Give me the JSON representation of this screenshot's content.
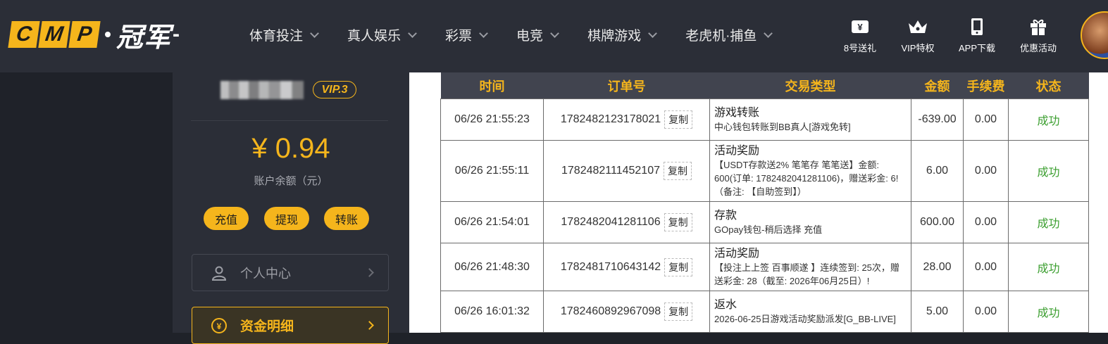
{
  "brand": {
    "logo_letters": [
      "C",
      "M",
      "P"
    ],
    "logo_cn": "冠军",
    "logo_dash": "-"
  },
  "nav": [
    {
      "label": "体育投注"
    },
    {
      "label": "真人娱乐"
    },
    {
      "label": "彩票"
    },
    {
      "label": "电竞"
    },
    {
      "label": "棋牌游戏"
    },
    {
      "label": "老虎机·捕鱼"
    }
  ],
  "quick_links": [
    {
      "label": "8号送礼",
      "icon": "gift-ticket-icon"
    },
    {
      "label": "VIP特权",
      "icon": "crown-icon"
    },
    {
      "label": "APP下载",
      "icon": "phone-icon"
    },
    {
      "label": "优惠活动",
      "icon": "gift-box-icon"
    }
  ],
  "account": {
    "vip": "VIP.3",
    "balance": "¥ 0.94",
    "balance_label": "账户余额（元）",
    "actions": [
      "充值",
      "提现",
      "转账"
    ],
    "menu_personal": "个人中心",
    "menu_funds": "资金明细"
  },
  "table": {
    "headers": [
      "时间",
      "订单号",
      "交易类型",
      "金额",
      "手续费",
      "状态"
    ],
    "copy_label": "复制",
    "rows": [
      {
        "time": "06/26 21:55:23",
        "order": "1782482123178021",
        "type": "游戏转账",
        "detail": "中心钱包转账到BB真人[游戏免转]",
        "amount": "-639.00",
        "fee": "0.00",
        "status": "成功"
      },
      {
        "time": "06/26 21:55:11",
        "order": "1782482111452107",
        "type": "活动奖励",
        "detail": "【USDT存款送2% 笔笔存 笔笔送】金额: 600(订单: 1782482041281106)，赠送彩金: 6!（备注: 【自助签到】）",
        "amount": "6.00",
        "fee": "0.00",
        "status": "成功"
      },
      {
        "time": "06/26 21:54:01",
        "order": "1782482041281106",
        "type": "存款",
        "detail": "GOpay钱包-稍后选择 充值",
        "amount": "600.00",
        "fee": "0.00",
        "status": "成功"
      },
      {
        "time": "06/26 21:48:30",
        "order": "1782481710643142",
        "type": "活动奖励",
        "detail": "【投注上上签 百事顺遂 】连续签到: 25次，赠送彩金: 28（截至: 2026年06月25日）!",
        "amount": "28.00",
        "fee": "0.00",
        "status": "成功"
      },
      {
        "time": "06/26 16:01:32",
        "order": "1782460892967098",
        "type": "返水",
        "detail": "2026-06-25日游戏活动奖励派发[G_BB-LIVE]",
        "amount": "5.00",
        "fee": "0.00",
        "status": "成功"
      }
    ]
  }
}
